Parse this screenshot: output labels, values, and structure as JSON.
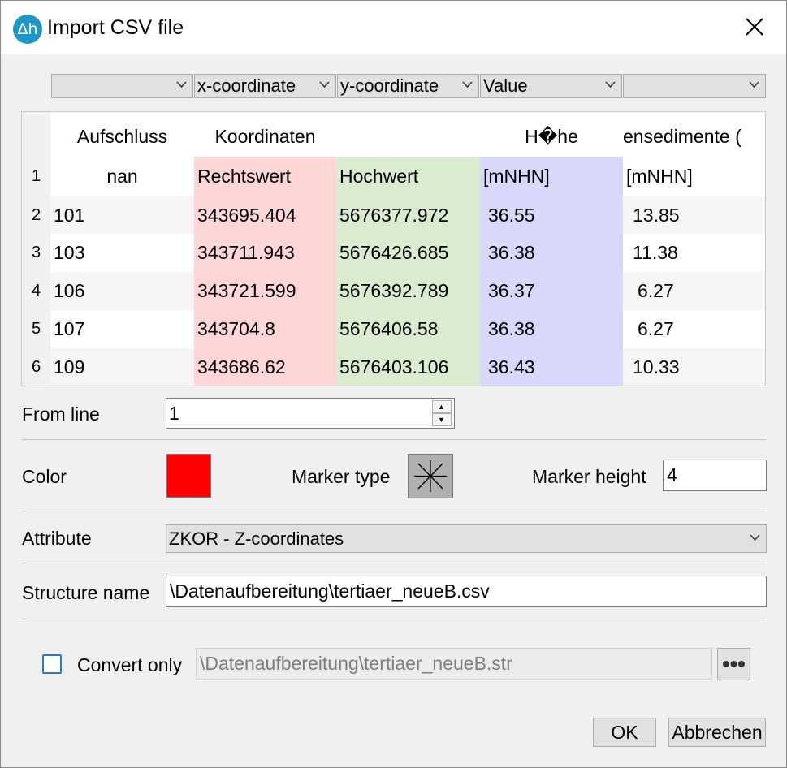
{
  "window": {
    "title": "Import CSV file",
    "app_icon": "Δh"
  },
  "column_mapping": [
    "",
    "x-coordinate",
    "y-coordinate",
    "Value",
    ""
  ],
  "table": {
    "headers": [
      "Aufschluss",
      "Koordinaten",
      "",
      "H�he",
      "ensedimente ("
    ],
    "rows": [
      {
        "num": "1",
        "cells": [
          "nan",
          "Rechtswert",
          "Hochwert",
          "[mNHN]",
          "[mNHN]"
        ]
      },
      {
        "num": "2",
        "cells": [
          "101",
          "343695.404",
          "5676377.972",
          "36.55",
          "13.85"
        ]
      },
      {
        "num": "3",
        "cells": [
          "103",
          "343711.943",
          "5676426.685",
          "36.38",
          "11.38"
        ]
      },
      {
        "num": "4",
        "cells": [
          "106",
          "343721.599",
          "5676392.789",
          "36.37",
          "6.27"
        ]
      },
      {
        "num": "5",
        "cells": [
          "107",
          "343704.8",
          "5676406.58",
          "36.38",
          "6.27"
        ]
      },
      {
        "num": "6",
        "cells": [
          "109",
          "343686.62",
          "5676403.106",
          "36.43",
          "10.33"
        ]
      }
    ],
    "colors": {
      "x": "#ffd6d6",
      "y": "#d9eccf",
      "value": "#d8d8fa"
    }
  },
  "from_line": {
    "label": "From line",
    "value": "1"
  },
  "color": {
    "label": "Color",
    "value": "#ff0000"
  },
  "marker_type": {
    "label": "Marker type",
    "icon": "asterisk-marker-icon"
  },
  "marker_height": {
    "label": "Marker height",
    "value": "4"
  },
  "attribute": {
    "label": "Attribute",
    "value": "ZKOR - Z-coordinates"
  },
  "structure_name": {
    "label": "Structure name",
    "value": "\\Datenaufbereitung\\tertiaer_neueB.csv"
  },
  "convert_only": {
    "label": "Convert only",
    "checked": false,
    "path": "\\Datenaufbereitung\\tertiaer_neueB.str"
  },
  "buttons": {
    "ok": "OK",
    "cancel": "Abbrechen"
  }
}
